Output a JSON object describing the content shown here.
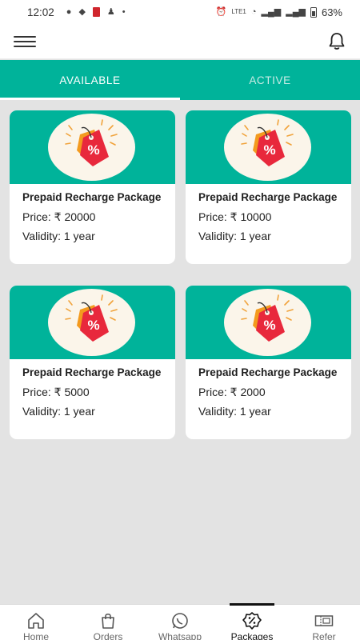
{
  "status_bar": {
    "time": "12:02",
    "network_label": "LTE1",
    "battery": "63%"
  },
  "app_bar": {
    "menu_icon": "hamburger-menu-icon",
    "notification_icon": "bell-icon"
  },
  "tabs": [
    {
      "label": "AVAILABLE",
      "active": true
    },
    {
      "label": "ACTIVE",
      "active": false
    }
  ],
  "packages": [
    {
      "title": "Prepaid Recharge Package",
      "price": "Price: ₹ 20000",
      "validity": "Validity: 1 year",
      "icon": "discount-tag-icon"
    },
    {
      "title": "Prepaid Recharge Package",
      "price": "Price: ₹ 10000",
      "validity": "Validity: 1 year",
      "icon": "discount-tag-icon"
    },
    {
      "title": "Prepaid Recharge Package",
      "price": "Price: ₹ 5000",
      "validity": "Validity: 1 year",
      "icon": "discount-tag-icon"
    },
    {
      "title": "Prepaid Recharge Package",
      "price": "Price: ₹ 2000",
      "validity": "Validity: 1 year",
      "icon": "discount-tag-icon"
    }
  ],
  "bottom_nav": [
    {
      "label": "Home",
      "icon": "home-icon",
      "active": false
    },
    {
      "label": "Orders",
      "icon": "shopping-bag-icon",
      "active": false
    },
    {
      "label": "Whatsapp",
      "icon": "whatsapp-icon",
      "active": false
    },
    {
      "label": "Packages",
      "icon": "percent-badge-icon",
      "active": true
    },
    {
      "label": "Refer",
      "icon": "refer-ticket-icon",
      "active": false
    }
  ],
  "colors": {
    "accent": "#00b39a",
    "background": "#e3e3e3",
    "tag_red": "#e8283c",
    "tag_orange": "#f39a1e"
  }
}
